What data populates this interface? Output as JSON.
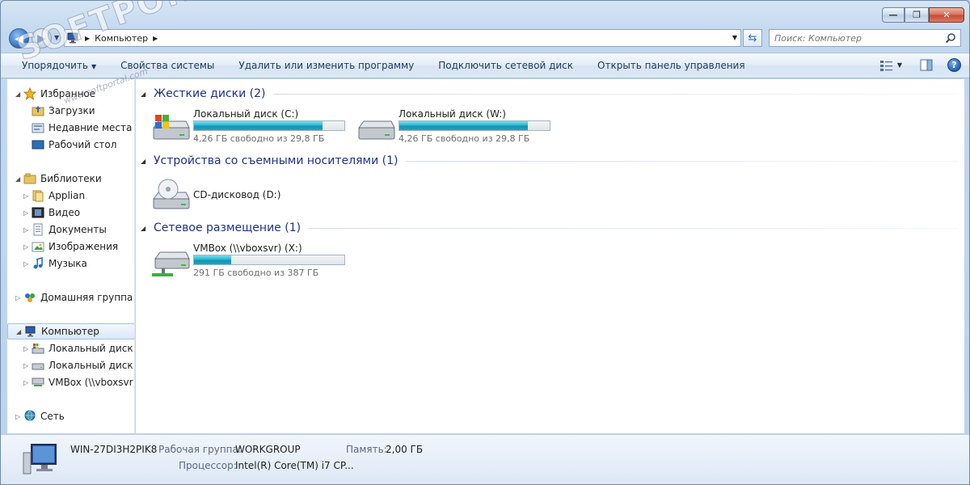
{
  "window": {
    "caption_buttons": {
      "minimize": "—",
      "maximize": "❐",
      "close": "✕"
    }
  },
  "address": {
    "path": "Компьютер",
    "search_placeholder": "Поиск: Компьютер"
  },
  "commands": {
    "organize": "Упорядочить",
    "system_properties": "Свойства системы",
    "uninstall": "Удалить или изменить программу",
    "map_drive": "Подключить сетевой диск",
    "control_panel": "Открыть панель управления",
    "help": "?"
  },
  "nav": {
    "favorites": "Избранное",
    "downloads": "Загрузки",
    "recent": "Недавние места",
    "desktop": "Рабочий стол",
    "libraries": "Библиотеки",
    "applian": "Applian",
    "video": "Видео",
    "documents": "Документы",
    "pictures": "Изображения",
    "music": "Музыка",
    "homegroup": "Домашняя группа",
    "computer": "Компьютер",
    "disk_c": "Локальный диск (C",
    "disk_w": "Локальный диск (W",
    "vmbox": "VMBox (\\\\vboxsvr) (",
    "network": "Сеть"
  },
  "groups": {
    "hard_disks": "Жесткие диски (2)",
    "removable": "Устройства со съемными носителями (1)",
    "network_location": "Сетевое размещение (1)"
  },
  "drives": {
    "c": {
      "name": "Локальный диск (C:)",
      "info": "4,26 ГБ свободно из 29,8 ГБ",
      "used_fraction": 0.857
    },
    "w": {
      "name": "Локальный диск (W:)",
      "info": "4,26 ГБ свободно из 29,8 ГБ",
      "used_fraction": 0.857
    },
    "d": {
      "name": "CD-дисковод (D:)"
    },
    "x": {
      "name": "VMBox (\\\\vboxsvr) (X:)",
      "info": "291 ГБ свободно из 387 ГБ",
      "used_fraction": 0.248
    }
  },
  "details": {
    "computer_name": "WIN-27DI3H2PIK8",
    "workgroup_label": "Рабочая группа:",
    "workgroup_value": "WORKGROUP",
    "memory_label": "Память:",
    "memory_value": "2,00 ГБ",
    "cpu_label": "Процессор:",
    "cpu_value": "Intel(R) Core(TM) i7 CP..."
  },
  "watermark": {
    "logo": "SOFTPORTAL",
    "sub": "www.softportal.com"
  },
  "colors": {
    "group_title": "#1e3287",
    "bar_fill": "#1393b5"
  }
}
